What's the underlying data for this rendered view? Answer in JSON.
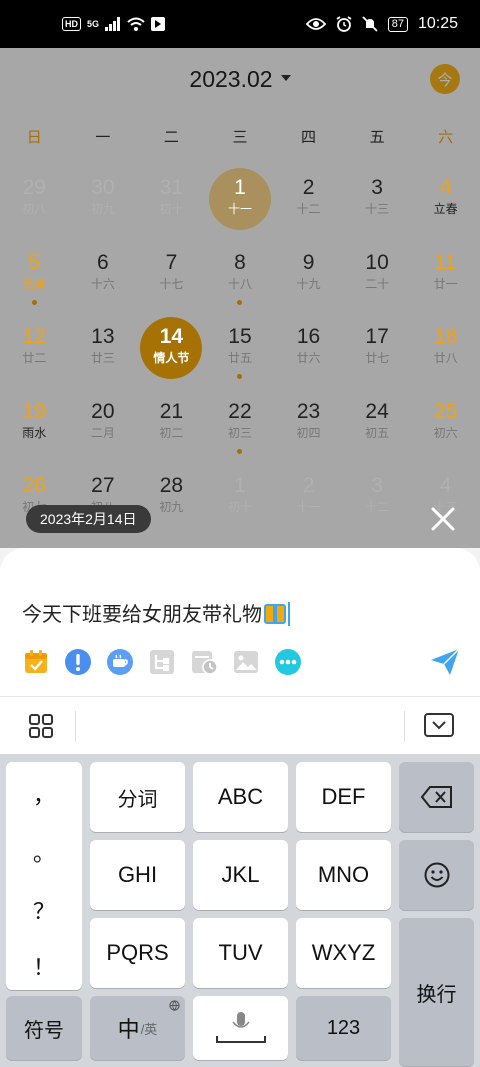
{
  "status_bar": {
    "left_chips": [
      "HD",
      "5G"
    ],
    "battery": "87",
    "time": "10:25"
  },
  "calendar": {
    "month_label": "2023.02",
    "today_button": "今",
    "weekdays": [
      "日",
      "一",
      "二",
      "三",
      "四",
      "五",
      "六"
    ],
    "days": [
      {
        "d": "29",
        "l": "初八",
        "other": true
      },
      {
        "d": "30",
        "l": "初九",
        "other": true
      },
      {
        "d": "31",
        "l": "初十",
        "other": true
      },
      {
        "d": "1",
        "l": "十一",
        "today": true
      },
      {
        "d": "2",
        "l": "十二"
      },
      {
        "d": "3",
        "l": "十三"
      },
      {
        "d": "4",
        "l": "立春",
        "term": true
      },
      {
        "d": "5",
        "l": "元宵",
        "fest": true,
        "dot": true
      },
      {
        "d": "6",
        "l": "十六"
      },
      {
        "d": "7",
        "l": "十七"
      },
      {
        "d": "8",
        "l": "十八",
        "dot": true
      },
      {
        "d": "9",
        "l": "十九"
      },
      {
        "d": "10",
        "l": "二十"
      },
      {
        "d": "11",
        "l": "廿一"
      },
      {
        "d": "12",
        "l": "廿二"
      },
      {
        "d": "13",
        "l": "廿三"
      },
      {
        "d": "14",
        "l": "情人节",
        "selected": true
      },
      {
        "d": "15",
        "l": "廿五",
        "dot": true
      },
      {
        "d": "16",
        "l": "廿六"
      },
      {
        "d": "17",
        "l": "廿七"
      },
      {
        "d": "18",
        "l": "廿八"
      },
      {
        "d": "19",
        "l": "雨水",
        "term": true
      },
      {
        "d": "20",
        "l": "二月"
      },
      {
        "d": "21",
        "l": "初二"
      },
      {
        "d": "22",
        "l": "初三",
        "dot": true
      },
      {
        "d": "23",
        "l": "初四"
      },
      {
        "d": "24",
        "l": "初五"
      },
      {
        "d": "25",
        "l": "初六"
      },
      {
        "d": "26",
        "l": "初七"
      },
      {
        "d": "27",
        "l": "初八"
      },
      {
        "d": "28",
        "l": "初九"
      },
      {
        "d": "1",
        "l": "初十",
        "other": true
      },
      {
        "d": "2",
        "l": "十一",
        "other": true
      },
      {
        "d": "3",
        "l": "十二",
        "other": true
      },
      {
        "d": "4",
        "l": "十三",
        "other": true
      }
    ],
    "colors": {
      "accent": "#f5a908",
      "weekend": "#f2a20f"
    }
  },
  "selected_date_tag": "2023年2月14日",
  "editor": {
    "text": "今天下班要给女朋友带礼物",
    "tools": [
      "calendar-icon",
      "priority-icon",
      "coffee-icon",
      "subtask-icon",
      "schedule-icon",
      "image-icon",
      "more-icon"
    ],
    "send_icon": "send-icon"
  },
  "keyboard": {
    "punctuation": [
      "，",
      "。",
      "？",
      "！"
    ],
    "keys": {
      "row1": [
        "分词",
        "ABC",
        "DEF"
      ],
      "row2": [
        "GHI",
        "JKL",
        "MNO"
      ],
      "row3": [
        "PQRS",
        "TUV",
        "WXYZ"
      ],
      "symbols": "符号",
      "lang_main": "中",
      "lang_sub": "/英",
      "numbers": "123",
      "enter": "换行"
    }
  }
}
